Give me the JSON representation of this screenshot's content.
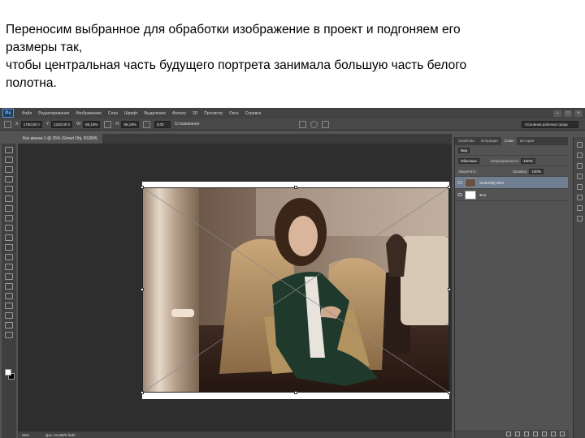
{
  "caption": {
    "line1": "Переносим выбранное для обработки изображение в проект и подгоняем его",
    "line2": "размеры так,",
    "line3": "чтобы центральная часть будущего портрета занимала большую часть белого",
    "line4": "полотна."
  },
  "app": {
    "logo": "Ps",
    "menu": [
      "Файл",
      "Редактирование",
      "Изображение",
      "Слои",
      "Шрифт",
      "Выделение",
      "Фильтр",
      "3D",
      "Просмотр",
      "Окно",
      "Справка"
    ],
    "window_controls": [
      "–",
      "□",
      "×"
    ]
  },
  "options": {
    "x_label": "X:",
    "x_value": "1750,00 п",
    "y_label": "Y:",
    "y_value": "1240,00 п",
    "w_label": "W:",
    "w_value": "96,19%",
    "h_label": "H:",
    "h_value": "96,19%",
    "angle_value": "0,00",
    "interp_label": "Сглаживание",
    "workspace": "Основная рабочая среда"
  },
  "document": {
    "tab_title": "Без имени-1 @ 25% (Smart Obj, RGB/8)",
    "zoom": "25%",
    "doc_info": "Док: 24,9M/0 байт"
  },
  "panels": {
    "tabs": [
      "Свойства",
      "Операции",
      "Слои",
      "История"
    ],
    "kind_label": "Вид",
    "blend_mode": "Обычные",
    "opacity_label": "Непрозрачность:",
    "opacity_value": "100%",
    "lock_label": "Закрепить:",
    "fill_label": "Заливка:",
    "fill_value": "100%",
    "layers": [
      {
        "name": "SmartObj 0001",
        "active": true
      },
      {
        "name": "Фон",
        "active": false
      }
    ]
  },
  "colors": {
    "workspace_bg": "#535353",
    "canvas_bg": "#2e2e2e",
    "layer_selected": "#6f7f91"
  },
  "icons": [
    "move-tool-icon",
    "marquee-tool-icon",
    "lasso-tool-icon",
    "crop-tool-icon",
    "brush-tool-icon",
    "eye-icon",
    "cancel-transform-icon",
    "commit-transform-icon"
  ]
}
